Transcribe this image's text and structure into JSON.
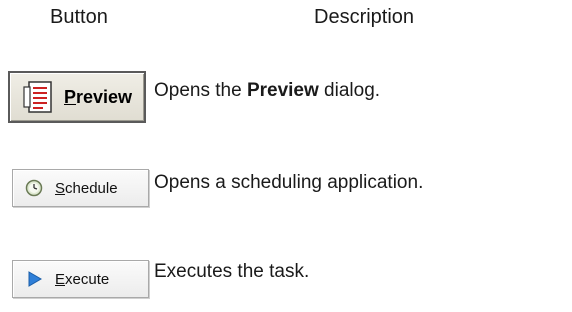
{
  "headers": {
    "button": "Button",
    "description": "Description"
  },
  "rows": [
    {
      "button_label": "Preview",
      "desc_pre": "Opens the ",
      "desc_bold": "Preview",
      "desc_post": " dialog.",
      "icon": "preview-document-icon"
    },
    {
      "button_label": "Schedule",
      "desc": "Opens a scheduling application.",
      "icon": "clock-icon"
    },
    {
      "button_label": "Execute",
      "desc": "Executes the task.",
      "icon": "play-triangle-icon"
    }
  ]
}
